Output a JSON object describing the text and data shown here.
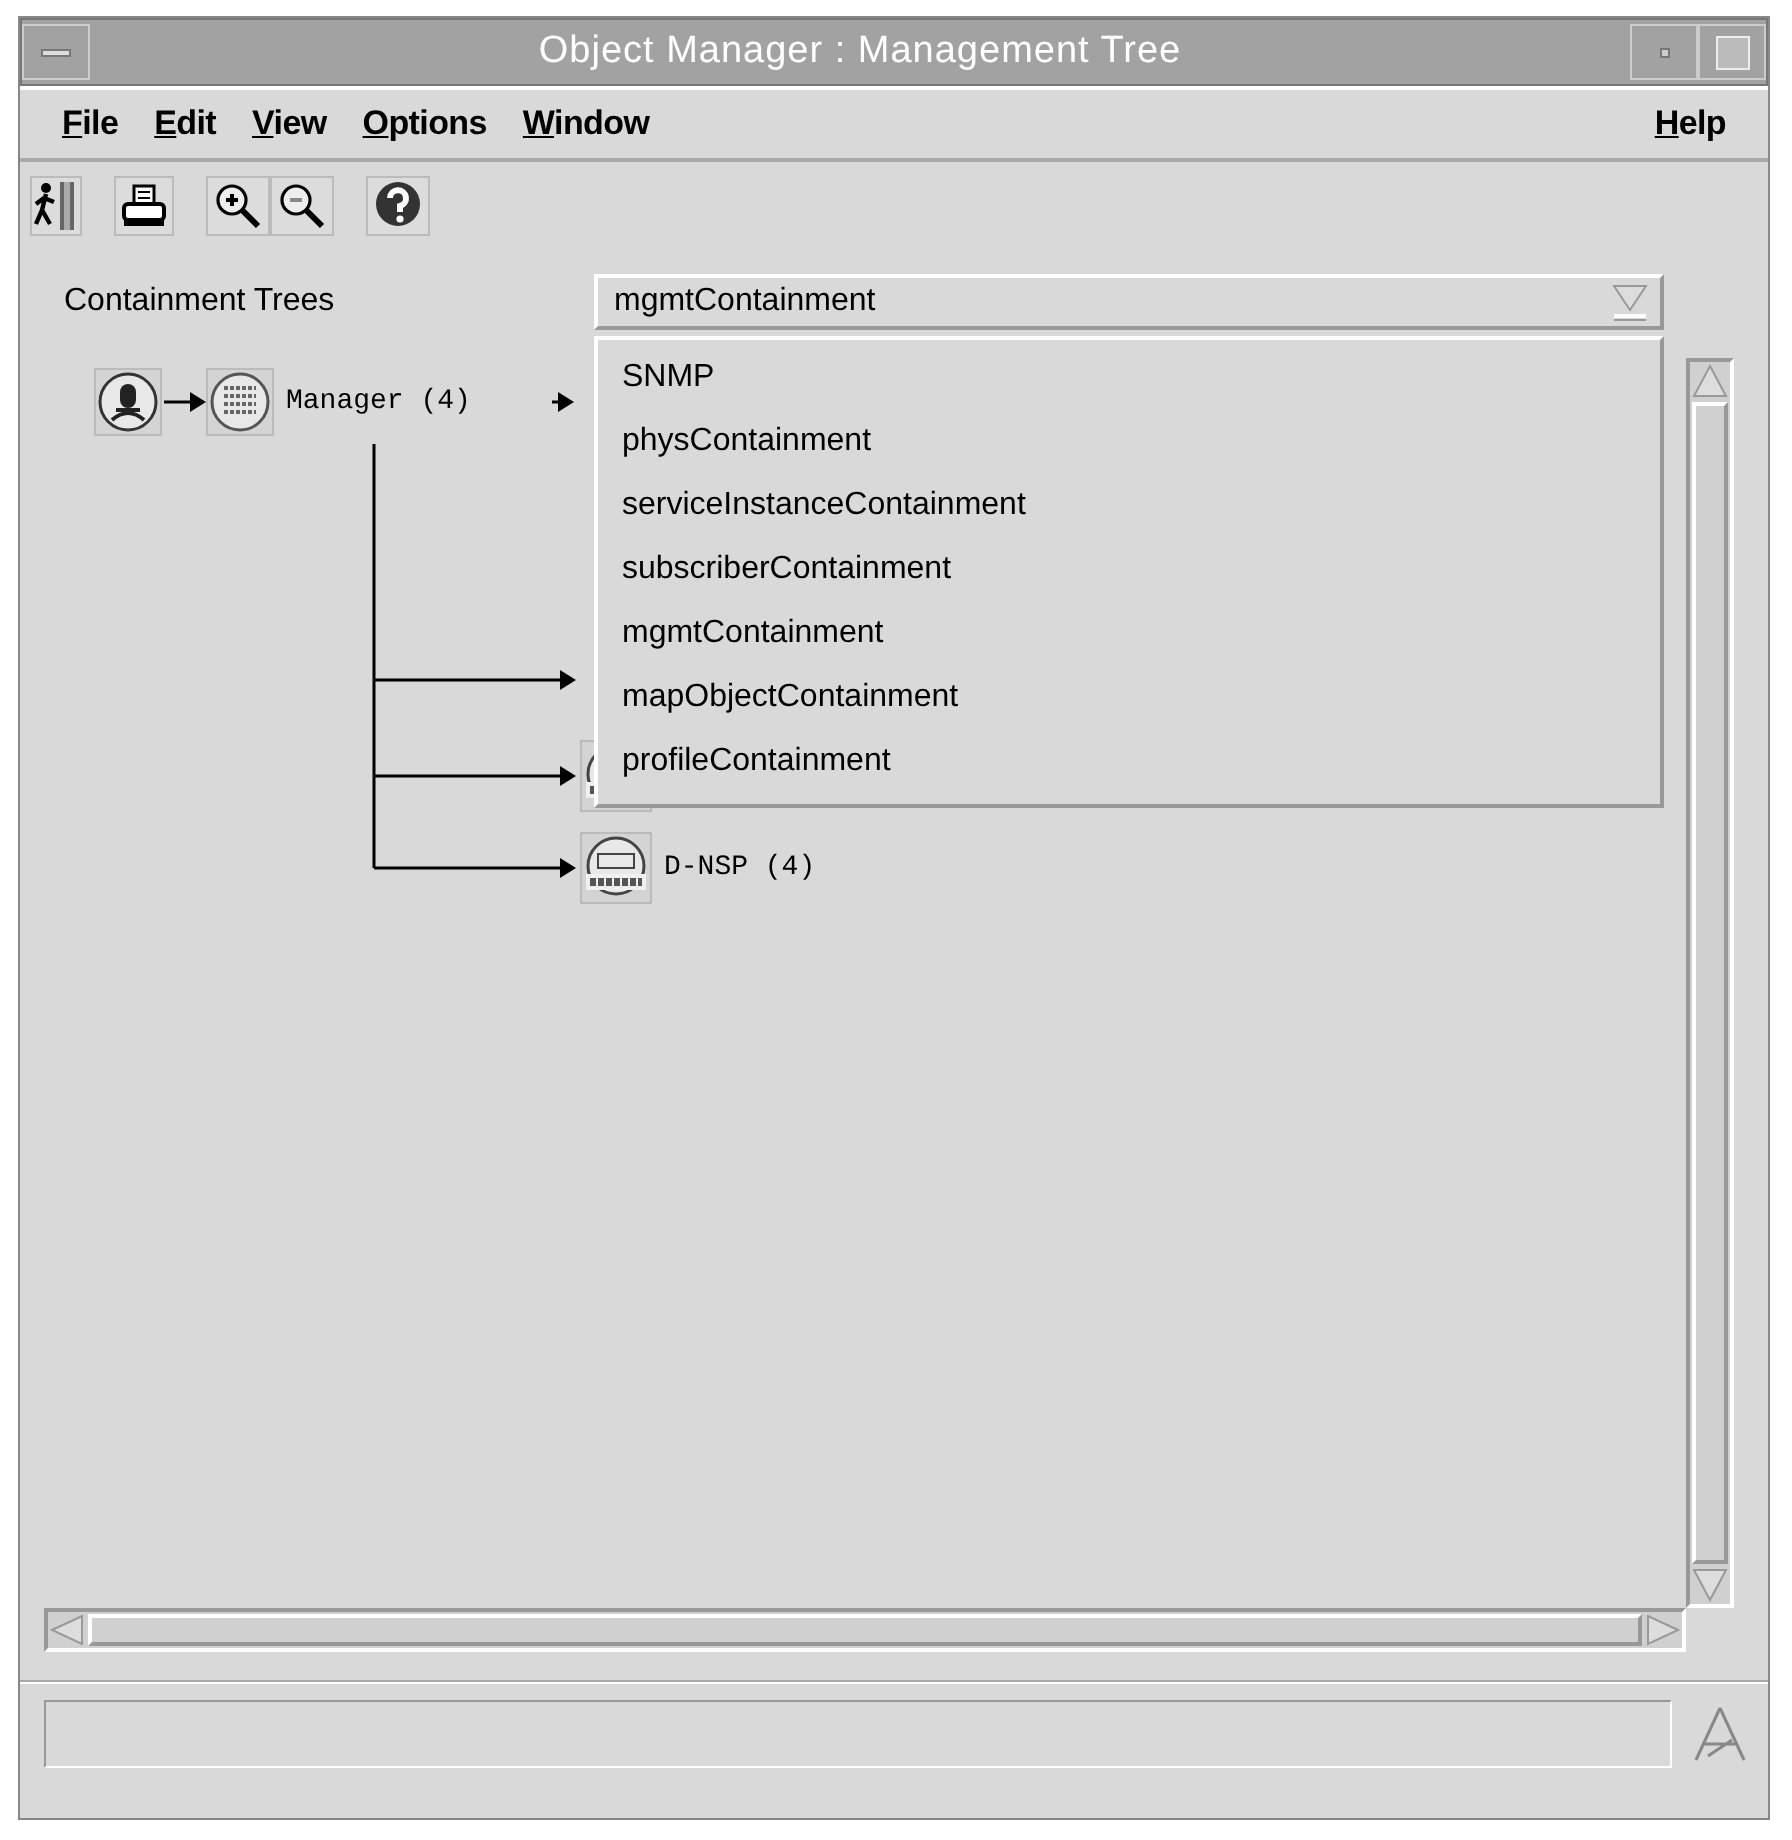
{
  "window": {
    "title": "Object Manager : Management Tree"
  },
  "menu": [
    "File",
    "Edit",
    "View",
    "Options",
    "Window"
  ],
  "help_menu": "Help",
  "toolbar": [
    [
      {
        "kind": "exit"
      }
    ],
    [
      {
        "kind": "print"
      }
    ],
    [
      {
        "kind": "zoom-in"
      },
      {
        "kind": "zoom-out"
      }
    ],
    [
      {
        "kind": "help"
      }
    ]
  ],
  "containment": {
    "label": "Containment Trees",
    "value": "mgmtContainment",
    "expanded": true,
    "options": [
      "SNMP",
      "physContainment",
      "serviceInstanceContainment",
      "subscriberContainment",
      "mgmtContainment",
      "mapObjectContainment",
      "profileContainment"
    ]
  },
  "tree": {
    "root": {
      "kind": "station",
      "children": [
        {
          "kind": "manager",
          "label": "Manager (4)",
          "children": [
            {
              "kind": "snmp",
              "label": "D-NSP (4)"
            }
          ]
        }
      ]
    }
  }
}
